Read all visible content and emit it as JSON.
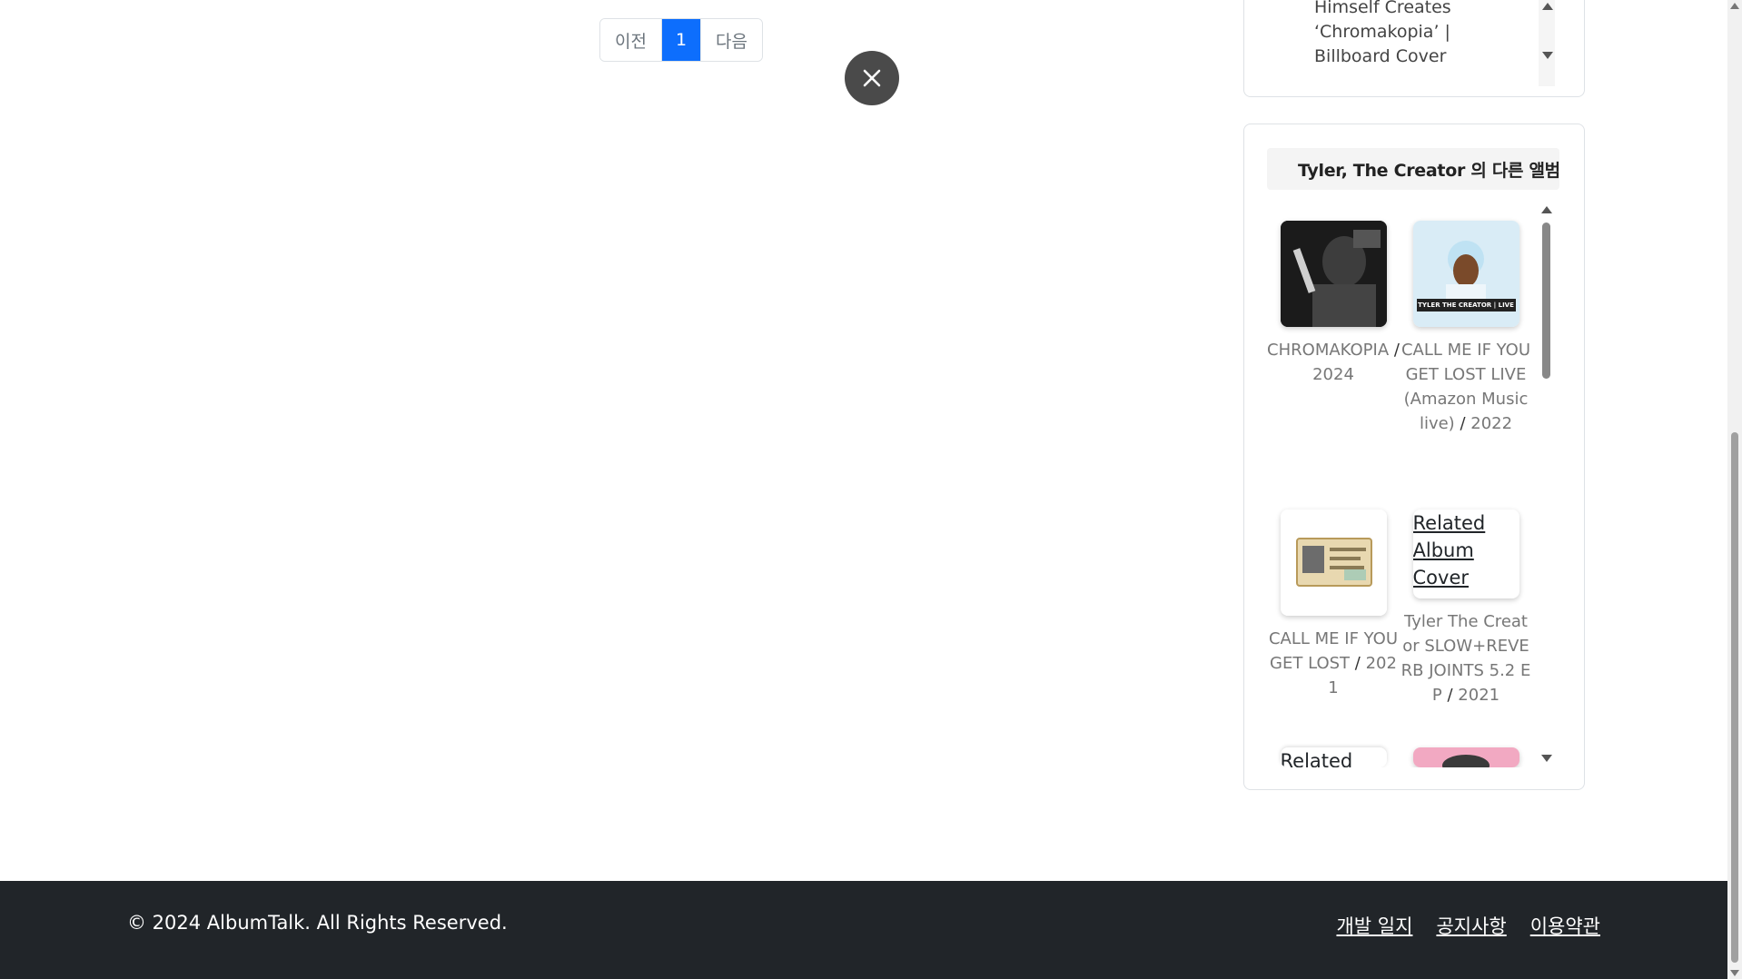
{
  "pagination": {
    "prev_label": "이전",
    "current_page": "1",
    "next_label": "다음"
  },
  "news": {
    "text": "Himself Creates ‘Chromakopia’ | Billboard Cover"
  },
  "related_albums": {
    "title": "Tyler, The Creator 의 다른 앨범",
    "separator": "/",
    "items": [
      {
        "name": "CHROMAKOPIA",
        "year": "2024"
      },
      {
        "name": "CALL ME IF YOU GET LOST LIVE (Amazon Music live)",
        "year": "2022",
        "cover_text": "TYLER THE CREATOR | LIVE"
      },
      {
        "name": "CALL ME IF YOU GET LOST",
        "year": "2021"
      },
      {
        "name": "Tyler The Creator SLOW+REVERB JOINTS 5.2 EP",
        "year": "2021",
        "alt": "Related Album Cover"
      },
      {
        "alt": "Related"
      }
    ]
  },
  "footer": {
    "copyright": "© 2024 AlbumTalk. All Rights Reserved.",
    "links": [
      "개발 일지",
      "공지사항",
      "이용약관"
    ]
  },
  "colors": {
    "accent": "#0d6efd",
    "footer_bg": "#212529"
  }
}
